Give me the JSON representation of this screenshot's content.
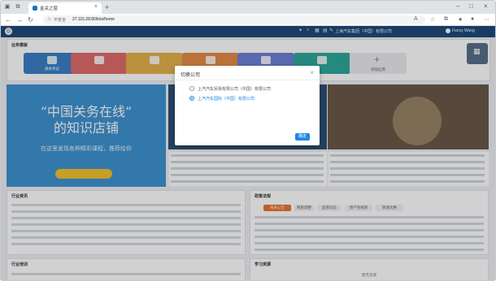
{
  "browser": {
    "tab_title": "金关之窗",
    "new_tab": "+",
    "security_label": "不安全",
    "url": "27.115.28.80/kris/home"
  },
  "header": {
    "company": "上海汽车集团（中国）有限公司",
    "user": "Fancy Wang"
  },
  "quick_entries": {
    "title": "业务模板",
    "colors": [
      "#3b7fc7",
      "#e06c6c",
      "#e3b04b",
      "#e58a46",
      "#6d7fd6",
      "#2fa89b"
    ],
    "tiles": [
      "通关单证",
      "",
      "",
      "",
      "",
      ""
    ],
    "add_label": "添加应用"
  },
  "banner": {
    "line1": "“中国关务在线”",
    "line2": "的知识店铺",
    "line3": "在这里发现各种精彩课程，推荐给你"
  },
  "panels": {
    "left_title": "行业资讯",
    "right_title": "政策法规",
    "bottom_left_title": "行业培训",
    "bottom_right_title": "学习资源",
    "bottom_right_sub": "暂无资源",
    "tabs": [
      "海关公告",
      "税则调整",
      "监管动态",
      "原产地规则",
      "税收优惠"
    ]
  },
  "dialog": {
    "title": "切换公司",
    "close": "×",
    "options": [
      {
        "label": "上汽汽车贸易有限公司（中国）有限公司",
        "selected": false
      },
      {
        "label": "上汽汽车国际（中国）有限公司",
        "selected": true
      }
    ],
    "ok": "确定"
  }
}
